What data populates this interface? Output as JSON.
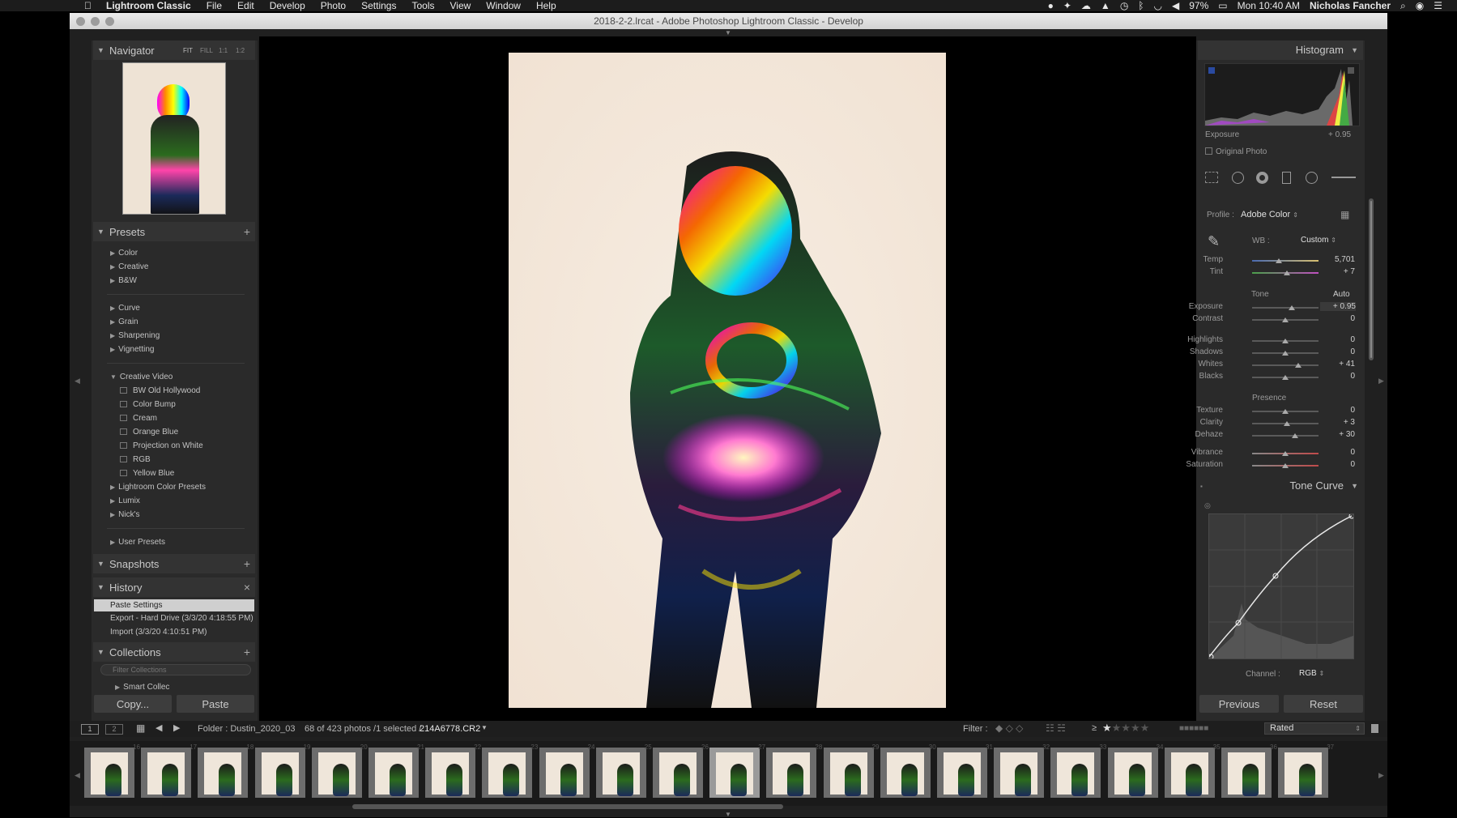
{
  "menubar": {
    "app": "Lightroom Classic",
    "items": [
      "File",
      "Edit",
      "Develop",
      "Photo",
      "Settings",
      "Tools",
      "View",
      "Window",
      "Help"
    ],
    "battery": "97%",
    "clock": "Mon 10:40 AM",
    "user": "Nicholas Fancher"
  },
  "window": {
    "title": "2018-2-2.lrcat - Adobe Photoshop Lightroom Classic - Develop"
  },
  "navigator": {
    "title": "Navigator",
    "zoom": [
      "FIT",
      "FILL",
      "1:1",
      "1:2"
    ]
  },
  "presets": {
    "title": "Presets",
    "groups1": [
      "Color",
      "Creative",
      "B&W"
    ],
    "groups2": [
      "Curve",
      "Grain",
      "Sharpening",
      "Vignetting"
    ],
    "open_group": "Creative Video",
    "open_items": [
      "BW Old Hollywood",
      "Color Bump",
      "Cream",
      "Orange Blue",
      "Projection on White",
      "RGB",
      "Yellow Blue"
    ],
    "groups3": [
      "Lightroom Color Presets",
      "Lumix",
      "Nick's"
    ],
    "user": "User Presets"
  },
  "snapshots": {
    "title": "Snapshots"
  },
  "history": {
    "title": "History",
    "items": [
      "Paste Settings",
      "Export - Hard Drive (3/3/20 4:18:55 PM)",
      "Import (3/3/20 4:10:51 PM)"
    ]
  },
  "collections": {
    "title": "Collections",
    "filter_placeholder": "Filter Collections",
    "smart": "Smart Collec"
  },
  "left_buttons": {
    "copy": "Copy...",
    "paste": "Paste"
  },
  "histogram": {
    "title": "Histogram",
    "exposure_label": "Exposure",
    "exposure_value": "+ 0.95",
    "original": "Original Photo"
  },
  "basic": {
    "profile_label": "Profile :",
    "profile_value": "Adobe Color",
    "wb_label": "WB :",
    "wb_value": "Custom",
    "temp_label": "Temp",
    "temp_value": "5,701",
    "tint_label": "Tint",
    "tint_value": "+ 7",
    "tone_label": "Tone",
    "auto": "Auto",
    "exposure_label": "Exposure",
    "exposure_value": "+ 0.95",
    "contrast_label": "Contrast",
    "contrast_value": "0",
    "highlights_label": "Highlights",
    "highlights_value": "0",
    "shadows_label": "Shadows",
    "shadows_value": "0",
    "whites_label": "Whites",
    "whites_value": "+ 41",
    "blacks_label": "Blacks",
    "blacks_value": "0",
    "presence_label": "Presence",
    "texture_label": "Texture",
    "texture_value": "0",
    "clarity_label": "Clarity",
    "clarity_value": "+ 3",
    "dehaze_label": "Dehaze",
    "dehaze_value": "+ 30",
    "vibrance_label": "Vibrance",
    "vibrance_value": "0",
    "saturation_label": "Saturation",
    "saturation_value": "0"
  },
  "tonecurve": {
    "title": "Tone Curve",
    "channel_label": "Channel :",
    "channel_value": "RGB"
  },
  "right_buttons": {
    "previous": "Previous",
    "reset": "Reset"
  },
  "filmbar": {
    "views": [
      "1",
      "2"
    ],
    "folder": "Folder : Dustin_2020_03",
    "count": "68 of 423 photos /1 selected /",
    "filename": "214A6778.CR2",
    "filter_label": "Filter :",
    "ge": "≥",
    "rated": "Rated"
  },
  "film_numbers": [
    "16",
    "17",
    "18",
    "19",
    "20",
    "21",
    "22",
    "23",
    "24",
    "25",
    "26",
    "27",
    "28",
    "29",
    "30",
    "31",
    "32",
    "33",
    "34",
    "35",
    "36",
    "37"
  ],
  "colors": {
    "panel": "#2a2a2a",
    "header": "#333333",
    "accent_selected": "#cfcfcf"
  }
}
